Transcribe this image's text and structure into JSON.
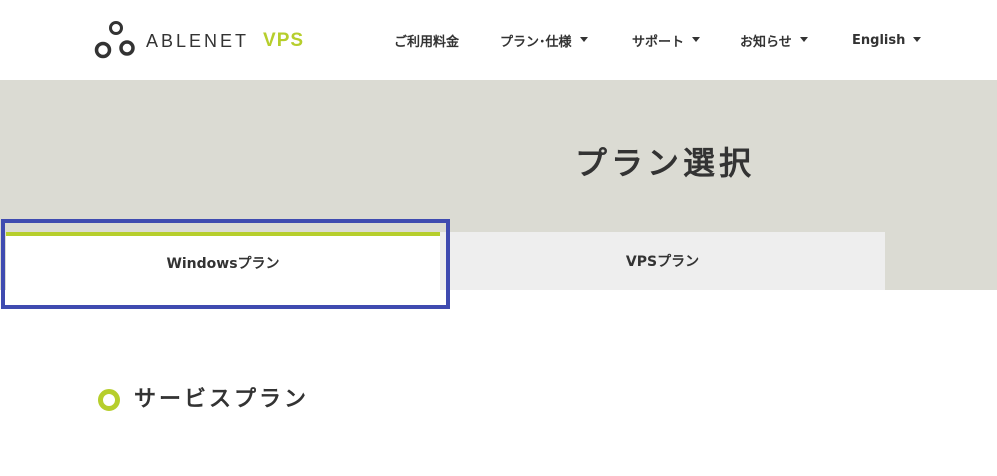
{
  "header": {
    "logo": {
      "brand": "ABLENET",
      "product": "VPS"
    },
    "nav": [
      {
        "label": "ご利用料金",
        "has_dropdown": false
      },
      {
        "label": "プラン･仕様",
        "has_dropdown": true
      },
      {
        "label": "サポート",
        "has_dropdown": true
      },
      {
        "label": "お知らせ",
        "has_dropdown": true
      },
      {
        "label": "English",
        "has_dropdown": true
      }
    ]
  },
  "hero": {
    "title": "プラン選択"
  },
  "tabs": [
    {
      "label": "Windowsプラン",
      "active": true
    },
    {
      "label": "VPSプラン",
      "active": false
    }
  ],
  "section": {
    "title": "サービスプラン"
  },
  "colors": {
    "accent_green": "#b6ce2c",
    "hero_bg": "#dbdbd3",
    "inactive_tab_bg": "#eeeeee",
    "highlight_border": "#3f4bb0",
    "text": "#333333"
  },
  "icons": {
    "logo_mark": "three-circle-logo-icon",
    "dropdown": "caret-down-icon",
    "section_marker": "ring-bullet-icon"
  }
}
